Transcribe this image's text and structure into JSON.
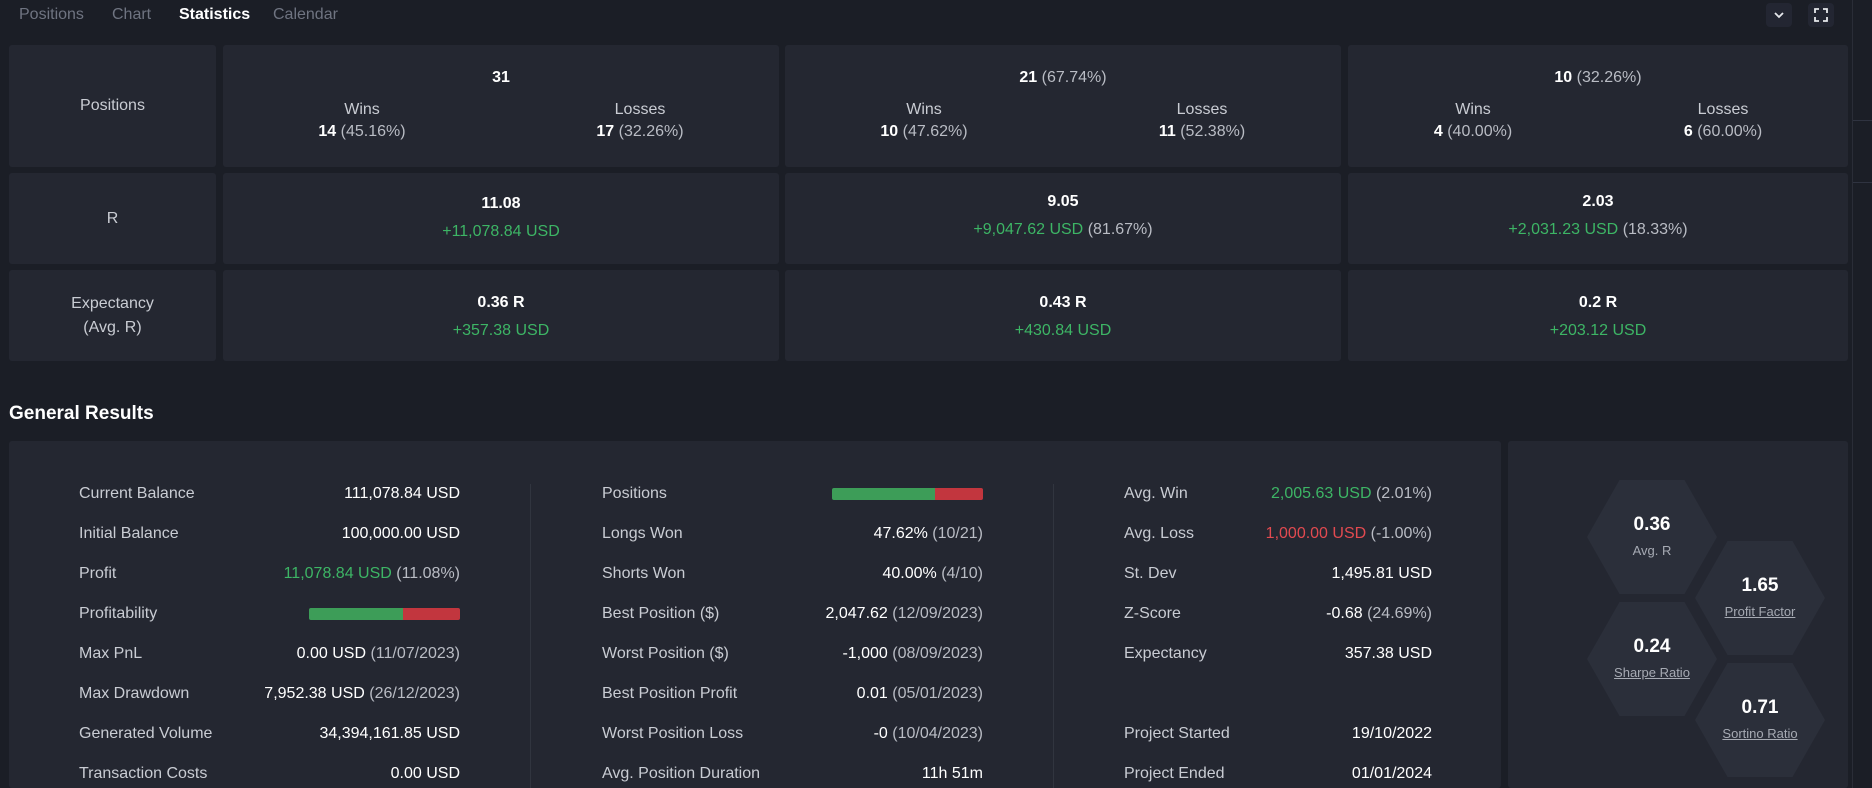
{
  "tabs": [
    {
      "label": "Positions",
      "active": false
    },
    {
      "label": "Chart",
      "active": false
    },
    {
      "label": "Statistics",
      "active": true
    },
    {
      "label": "Calendar",
      "active": false
    }
  ],
  "summary": {
    "positions": {
      "label": "Positions",
      "cols": [
        {
          "total": "31",
          "total_pct": "",
          "wins_label": "Wins",
          "wins": "14",
          "wins_pct": "(45.16%)",
          "losses_label": "Losses",
          "losses": "17",
          "losses_pct": "(32.26%)"
        },
        {
          "total": "21",
          "total_pct": "(67.74%)",
          "wins_label": "Wins",
          "wins": "10",
          "wins_pct": "(47.62%)",
          "losses_label": "Losses",
          "losses": "11",
          "losses_pct": "(52.38%)"
        },
        {
          "total": "10",
          "total_pct": "(32.26%)",
          "wins_label": "Wins",
          "wins": "4",
          "wins_pct": "(40.00%)",
          "losses_label": "Losses",
          "losses": "6",
          "losses_pct": "(60.00%)"
        }
      ]
    },
    "r": {
      "label": "R",
      "cols": [
        {
          "value": "11.08",
          "usd": "+11,078.84 USD",
          "pct": ""
        },
        {
          "value": "9.05",
          "usd": "+9,047.62 USD",
          "pct": "(81.67%)"
        },
        {
          "value": "2.03",
          "usd": "+2,031.23 USD",
          "pct": "(18.33%)"
        }
      ]
    },
    "expectancy": {
      "label_line1": "Expectancy",
      "label_line2": "(Avg. R)",
      "cols": [
        {
          "value": "0.36 R",
          "usd": "+357.38 USD"
        },
        {
          "value": "0.43 R",
          "usd": "+430.84 USD"
        },
        {
          "value": "0.2 R",
          "usd": "+203.12 USD"
        }
      ]
    }
  },
  "general_results": {
    "title": "General Results",
    "col1": [
      {
        "label": "Current Balance",
        "value": "111,078.84 USD",
        "paren": ""
      },
      {
        "label": "Initial Balance",
        "value": "100,000.00 USD",
        "paren": ""
      },
      {
        "label": "Profit",
        "value": "11,078.84 USD",
        "paren": "(11.08%)",
        "color": "green"
      },
      {
        "label": "Profitability",
        "bar_win_fraction": 0.625
      },
      {
        "label": "Max PnL",
        "value": "0.00 USD",
        "paren": "(11/07/2023)"
      },
      {
        "label": "Max Drawdown",
        "value": "7,952.38 USD",
        "paren": "(26/12/2023)"
      },
      {
        "label": "Generated Volume",
        "value": "34,394,161.85 USD",
        "paren": ""
      },
      {
        "label": "Transaction Costs",
        "value": "0.00 USD",
        "paren": ""
      }
    ],
    "col2": [
      {
        "label": "Positions",
        "bar_win_fraction": 0.68
      },
      {
        "label": "Longs Won",
        "value": "47.62%",
        "paren": "(10/21)"
      },
      {
        "label": "Shorts Won",
        "value": "40.00%",
        "paren": "(4/10)"
      },
      {
        "label": "Best Position ($)",
        "value": "2,047.62",
        "paren": "(12/09/2023)"
      },
      {
        "label": "Worst Position ($)",
        "value": "-1,000",
        "paren": "(08/09/2023)"
      },
      {
        "label": "Best Position Profit",
        "value": "0.01",
        "paren": "(05/01/2023)"
      },
      {
        "label": "Worst Position Loss",
        "value": "-0",
        "paren": "(10/04/2023)"
      },
      {
        "label": "Avg. Position Duration",
        "value": "11h 51m",
        "paren": ""
      }
    ],
    "col3": [
      {
        "label": "Avg. Win",
        "value": "2,005.63 USD",
        "paren": "(2.01%)",
        "color": "green"
      },
      {
        "label": "Avg. Loss",
        "value": "1,000.00 USD",
        "paren": "(-1.00%)",
        "color": "red"
      },
      {
        "label": "St. Dev",
        "value": "1,495.81 USD",
        "paren": ""
      },
      {
        "label": "Z-Score",
        "value": "-0.68",
        "paren": "(24.69%)"
      },
      {
        "label": "Expectancy",
        "value": "357.38 USD",
        "paren": ""
      },
      {
        "label": "",
        "value": "",
        "paren": ""
      },
      {
        "label": "Project Started",
        "value": "19/10/2022",
        "paren": ""
      },
      {
        "label": "Project Ended",
        "value": "01/01/2024",
        "paren": ""
      }
    ]
  },
  "ratios": [
    {
      "value": "0.36",
      "label": "Avg. R",
      "underline": false
    },
    {
      "value": "1.65",
      "label": "Profit Factor",
      "underline": true
    },
    {
      "value": "0.24",
      "label": "Sharpe Ratio",
      "underline": true
    },
    {
      "value": "0.71",
      "label": "Sortino Ratio",
      "underline": true
    }
  ],
  "colors": {
    "background": "#1b1e26",
    "card": "#242731",
    "green": "#3db565",
    "red": "#e24a50"
  },
  "icons": [
    "chevron-down-icon",
    "fullscreen-icon"
  ]
}
